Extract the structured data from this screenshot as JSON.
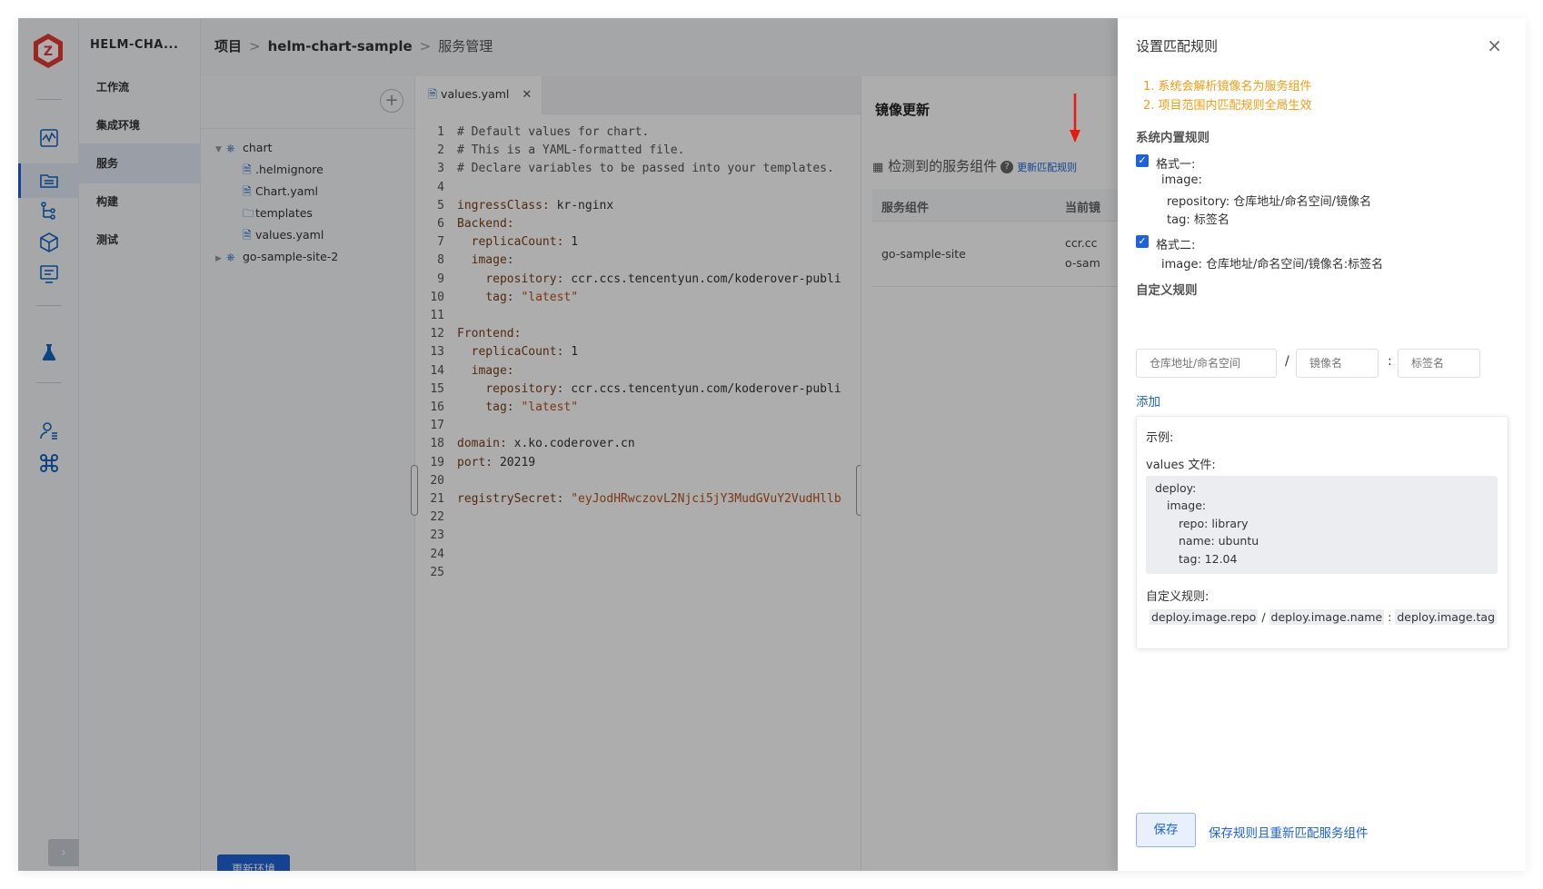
{
  "sidebar": {
    "project_name": "HELM-CHA...",
    "items": [
      {
        "label": "工作流"
      },
      {
        "label": "集成环境"
      },
      {
        "label": "服务"
      },
      {
        "label": "构建"
      },
      {
        "label": "测试"
      }
    ]
  },
  "breadcrumb": {
    "root": "项目",
    "sep1": ">",
    "project": "helm-chart-sample",
    "sep2": ">",
    "page": "服务管理"
  },
  "tree": {
    "add_symbol": "+",
    "nodes": [
      {
        "label": "chart",
        "type": "chart",
        "expanded": true
      },
      {
        "label": ".helmignore",
        "type": "file"
      },
      {
        "label": "Chart.yaml",
        "type": "file"
      },
      {
        "label": "templates",
        "type": "folder"
      },
      {
        "label": "values.yaml",
        "type": "file"
      },
      {
        "label": "go-sample-site-2",
        "type": "chart",
        "expanded": false
      }
    ],
    "update_env_button": "更新环境"
  },
  "editor": {
    "tab_label": "values.yaml",
    "lines": [
      "# Default values for chart.",
      "# This is a YAML-formatted file.",
      "# Declare variables to be passed into your templates.",
      "",
      "ingressClass: kr-nginx",
      "Backend:",
      "  replicaCount: 1",
      "  image:",
      "    repository: ccr.ccs.tencentyun.com/koderover-publi",
      "    tag: \"latest\"",
      "",
      "Frontend:",
      "  replicaCount: 1",
      "  image:",
      "    repository: ccr.ccs.tencentyun.com/koderover-publi",
      "    tag: \"latest\"",
      "",
      "domain: x.ko.coderover.cn",
      "port: 20219",
      "",
      "registrySecret: \"eyJodHRwczovL2Njci5jY3MudGVuY2VudHllb",
      "",
      "",
      "",
      ""
    ]
  },
  "image_update": {
    "title": "镜像更新",
    "detected_label": "检测到的服务组件",
    "help_symbol": "?",
    "update_rule_link": "更新匹配规则",
    "columns": [
      "服务组件",
      "当前镜"
    ],
    "rows": [
      {
        "component": "go-sample-site",
        "image_line1": "ccr.cc",
        "image_line2": "o-sam"
      }
    ]
  },
  "drawer": {
    "title": "设置匹配规则",
    "close_symbol": "×",
    "notes": [
      "1. 系统会解析镜像名为服务组件",
      "2. 项目范围内匹配规则全局生效"
    ],
    "builtin_title": "系统内置规则",
    "format1": {
      "checked": true,
      "label": "格式一:",
      "lines": [
        "image:",
        "repository: 仓库地址/命名空间/镜像名",
        "tag: 标签名"
      ]
    },
    "format2": {
      "checked": true,
      "label": "格式二:",
      "line": "image: 仓库地址/命名空间/镜像名:标签名"
    },
    "custom_title": "自定义规则",
    "inputs": {
      "repo_placeholder": "仓库地址/命名空间",
      "name_placeholder": "镜像名",
      "tag_placeholder": "标签名",
      "sep_slash": "/",
      "sep_colon": ":"
    },
    "add_label": "添加",
    "example": {
      "title": "示例:",
      "values_label": "values 文件:",
      "code_lines": [
        "deploy:",
        "image:",
        "repo: library",
        "name: ubuntu",
        "tag: 12.04"
      ],
      "rule_label": "自定义规则:",
      "rule_parts": [
        "deploy.image.repo",
        "/",
        "deploy.image.name",
        ":",
        "deploy.image.tag"
      ]
    },
    "save_button": "保存",
    "save_rematch_link": "保存规则且重新匹配服务组件"
  },
  "colors": {
    "primary": "#1e63d8",
    "note_orange": "#f39c12",
    "arrow_red": "#e8190f"
  }
}
